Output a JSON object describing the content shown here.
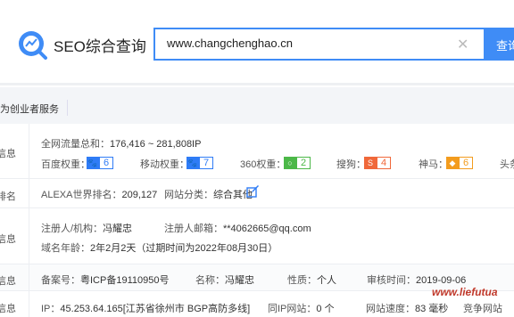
{
  "header": {
    "logo_text": "SEO综合查询",
    "search_value": "www.changchenghao.cn",
    "search_button": "查询"
  },
  "tagline": "为创业者服务",
  "rows": {
    "traffic": {
      "label": "信息",
      "total_label": "全网流量总和：",
      "total_value": "176,416 ~ 281,808IP",
      "baidu_label": "百度权重：",
      "baidu_value": "6",
      "mobile_label": "移动权重：",
      "mobile_value": "7",
      "q360_label": "360权重：",
      "q360_value": "2",
      "sogou_label": "搜狗：",
      "sogou_value": "4",
      "shenma_label": "神马：",
      "shenma_value": "6",
      "toutiao_label": "头条"
    },
    "rank": {
      "label": "排名",
      "alexa_label": "ALEXA世界排名：",
      "alexa_value": "209,127",
      "category_label": "网站分类：",
      "category_value": "综合其他"
    },
    "whois": {
      "label": "信息",
      "registrant_label": "注册人/机构：",
      "registrant_value": "冯耀忠",
      "email_label": "注册人邮箱：",
      "email_value": "**4062665@qq.com",
      "age_label": "域名年龄：",
      "age_value": "2年2月2天（过期时间为2022年08月30日）"
    },
    "icp": {
      "label": "信息",
      "beian_label": "备案号：",
      "beian_value": "粤ICP备19110950号",
      "name_label": "名称：",
      "name_value": "冯耀忠",
      "nature_label": "性质：",
      "nature_value": "个人",
      "audit_label": "审核时间：",
      "audit_value": "2019-09-06"
    },
    "server": {
      "label": "信息",
      "ip_label": "IP：",
      "ip_value": "45.253.64.165[江苏省徐州市 BGP高防多线]",
      "sameip_label": "同IP网站：",
      "sameip_value": "0 个",
      "speed_label": "网站速度：",
      "speed_value": "83 毫秒",
      "compete_label": "竞争网站"
    }
  },
  "watermark": "www.liefutua",
  "colors": {
    "accent": "#3f8cf6",
    "baidu": "#2f7cf6",
    "q360": "#4cb848",
    "sogou": "#f0683a",
    "shenma": "#f39c1e"
  }
}
